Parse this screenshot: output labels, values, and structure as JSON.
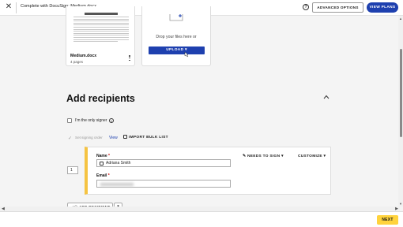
{
  "header": {
    "title": "Complete with DocuSign: Medium.docx",
    "advanced_options": "ADVANCED OPTIONS",
    "view_plans": "VIEW PLANS",
    "help_glyph": "?"
  },
  "document": {
    "name": "Medium.docx",
    "pages": "4 pages"
  },
  "upload": {
    "drop_text": "Drop your files here or",
    "button_label": "UPLOAD"
  },
  "recipients": {
    "section_title": "Add recipients",
    "only_signer_label": "I'm the only signer",
    "set_signing_order_label": "Set signing order",
    "view_link": "View",
    "import_bulk_list": "IMPORT BULK LIST",
    "items": [
      {
        "order": "1",
        "name_label": "Name",
        "name_value": "Adriana Smith",
        "email_label": "Email",
        "email_value": "",
        "action": "NEEDS TO SIGN",
        "customize": "CUSTOMIZE"
      }
    ],
    "add_recipient": "ADD RECIPIENT"
  },
  "footer": {
    "next_label": "NEXT"
  },
  "colors": {
    "primary": "#1e40af",
    "accent_yellow": "#ffd33d",
    "recipient_bar": "#f5c342"
  }
}
